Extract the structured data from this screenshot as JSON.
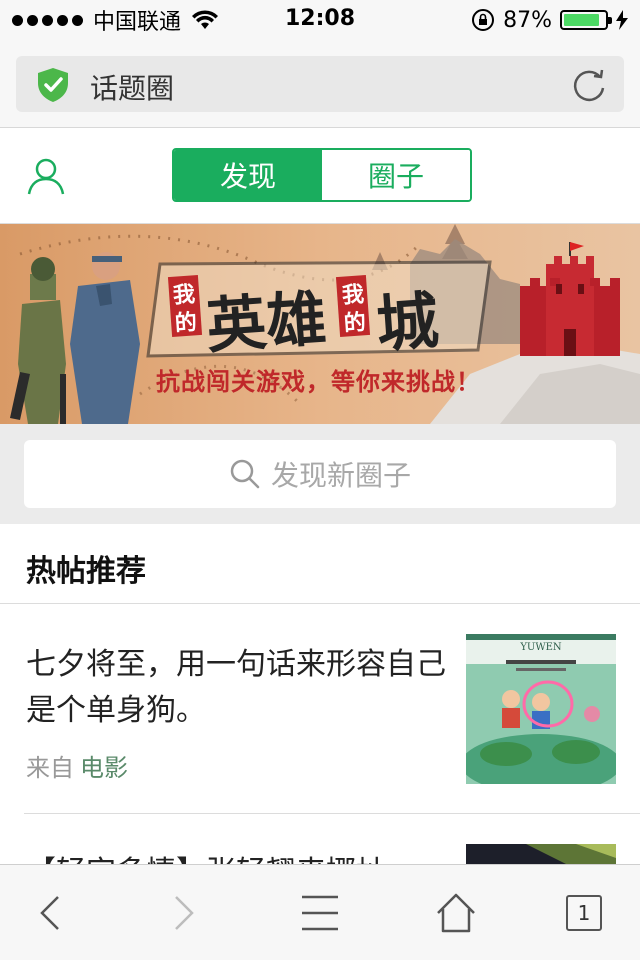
{
  "status_bar": {
    "carrier": "中国联通",
    "time": "12:08",
    "battery_percent": "87%",
    "battery_level": 0.87,
    "icons": [
      "signal-dots-icon",
      "wifi-icon",
      "rotation-lock-icon",
      "battery-icon",
      "charging-bolt-icon"
    ]
  },
  "address_bar": {
    "title": "话题圈",
    "icons": [
      "shield-check-icon",
      "reload-icon"
    ],
    "shield_color": "#4cb74a"
  },
  "header": {
    "tabs": [
      {
        "label": "发现",
        "active": true
      },
      {
        "label": "圈子",
        "active": false
      }
    ],
    "accent": "#1aad5e",
    "icons": [
      "user-icon"
    ]
  },
  "banner": {
    "title_words": [
      "我的",
      "英雄",
      "我的",
      "城"
    ],
    "subtitle": "抗战闯关游戏，等你来挑战！"
  },
  "search": {
    "placeholder": "发现新圈子"
  },
  "hot_posts": {
    "heading": "热帖推荐",
    "items": [
      {
        "title": "七夕将至，用一句话来形容自己是个单身狗。",
        "meta_prefix": "来自",
        "source": "电影",
        "thumb_text": "YUWEN"
      },
      {
        "title": "【轻宫多情】张轻翘来挪址",
        "meta_prefix": "",
        "source": "",
        "thumb_text": ""
      }
    ]
  },
  "toolbar": {
    "tab_count": "1",
    "icons": [
      "back-icon",
      "forward-icon",
      "menu-icon",
      "home-icon",
      "tabs-icon"
    ]
  }
}
